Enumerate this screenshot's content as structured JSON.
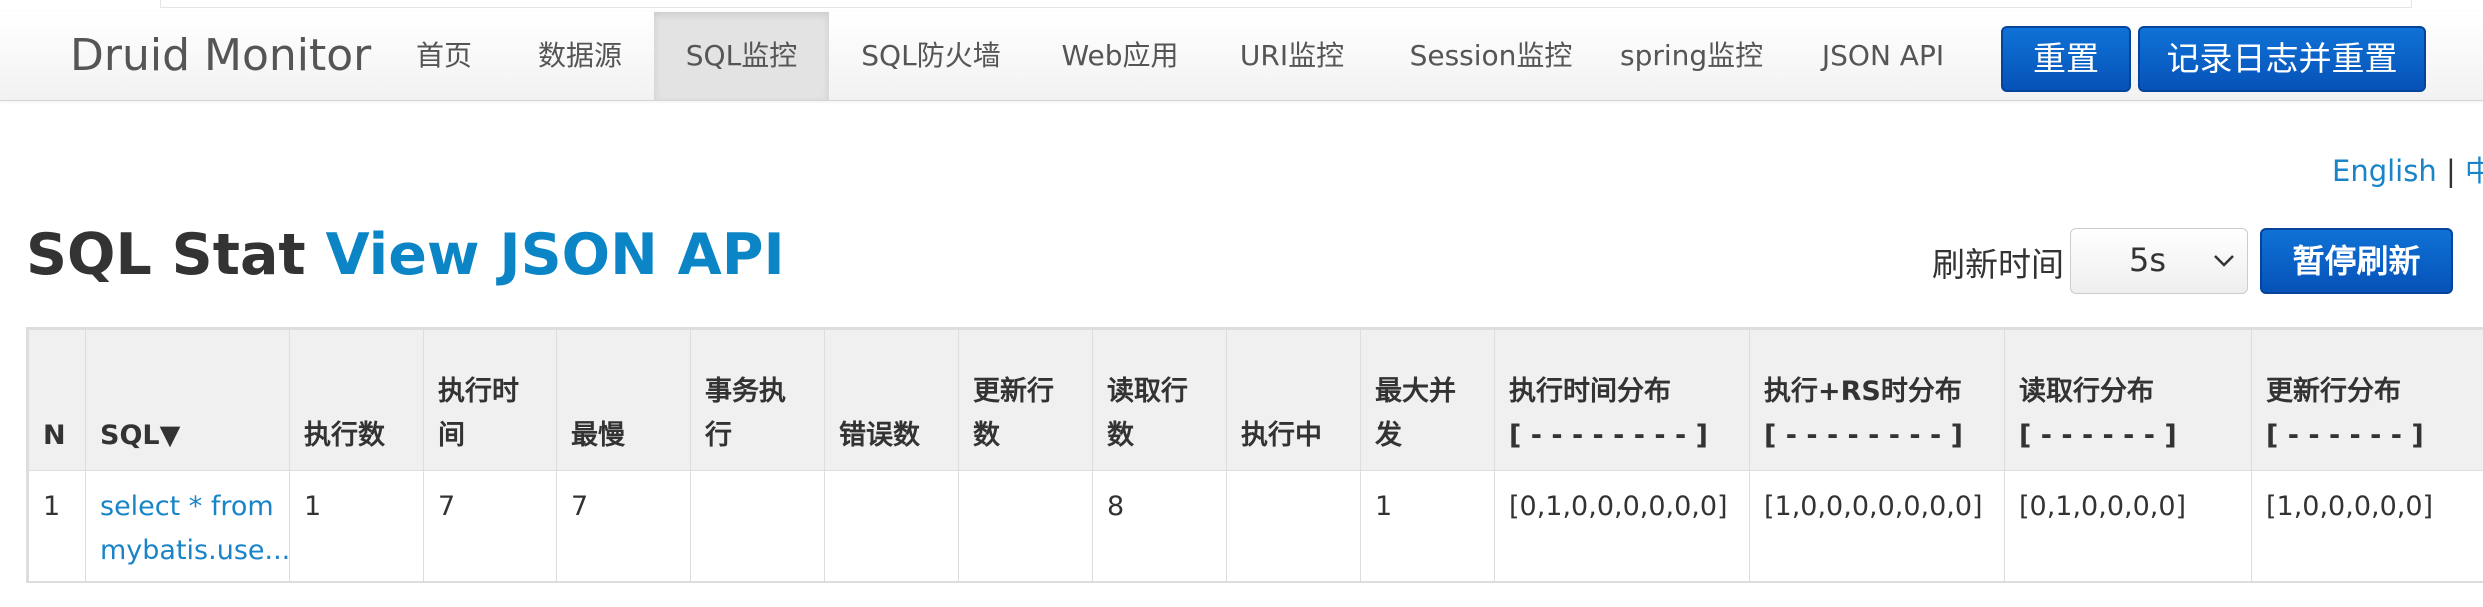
{
  "navbar": {
    "brand": "Druid Monitor",
    "items": [
      "首页",
      "数据源",
      "SQL监控",
      "SQL防火墙",
      "Web应用",
      "URI监控",
      "Session监控",
      "spring监控",
      "JSON API"
    ],
    "active_index": 2,
    "reset_button": "重置",
    "log_reset_button": "记录日志并重置"
  },
  "lang": {
    "english": "English",
    "separator": "|",
    "chinese": "中文"
  },
  "page": {
    "title": "SQL Stat",
    "title_link": "View JSON API",
    "refresh_label": "刷新时间",
    "refresh_value": "5s",
    "pause_button": "暂停刷新"
  },
  "table": {
    "headers": [
      [
        "N"
      ],
      [
        "SQL▼"
      ],
      [
        "执行数"
      ],
      [
        "执行时",
        "间"
      ],
      [
        "最慢"
      ],
      [
        "事务执",
        "行"
      ],
      [
        "错误数"
      ],
      [
        "更新行",
        "数"
      ],
      [
        "读取行",
        "数"
      ],
      [
        "执行中"
      ],
      [
        "最大并",
        "发"
      ],
      [
        "执行时间分布",
        "[ - - - - - - - - ]"
      ],
      [
        "执行+RS时分布",
        "[ - - - - - - - - ]"
      ],
      [
        "读取行分布",
        "[ - - - - - - ]"
      ],
      [
        "更新行分布",
        "[ - - - - - - ]"
      ]
    ],
    "rows": [
      {
        "n": "1",
        "sql": [
          "select * from",
          "mybatis.use..."
        ],
        "exec_count": "1",
        "exec_time": "7",
        "slowest": "7",
        "tx_exec": "",
        "error_count": "",
        "update_rows": "",
        "read_rows": "8",
        "running": "",
        "max_concurrent": "1",
        "exec_time_dist": "[0,1,0,0,0,0,0,0]",
        "exec_rs_dist": "[1,0,0,0,0,0,0,0]",
        "read_row_dist": "[0,1,0,0,0,0]",
        "update_row_dist": "[1,0,0,0,0,0]"
      }
    ]
  }
}
